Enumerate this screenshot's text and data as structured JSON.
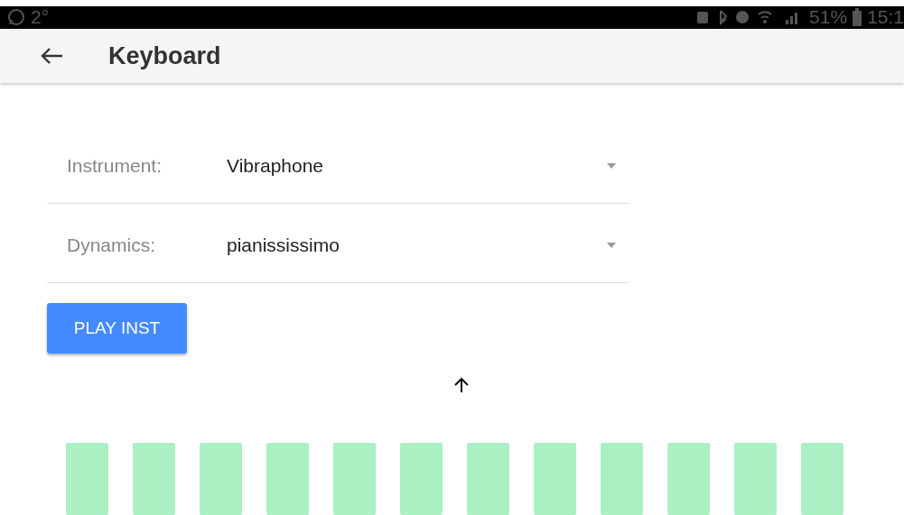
{
  "status_bar": {
    "temperature": "2°",
    "battery": "51%",
    "time": "15:1"
  },
  "app_bar": {
    "title": "Keyboard"
  },
  "fields": [
    {
      "label": "Instrument:",
      "value": "Vibraphone"
    },
    {
      "label": "Dynamics:",
      "value": "pianississimo"
    }
  ],
  "play_button": {
    "label": "PLAY INST"
  },
  "keys": [
    {
      "kind": "natural"
    },
    {
      "kind": "natural"
    },
    {
      "kind": "natural"
    },
    {
      "kind": "natural"
    },
    {
      "kind": "natural"
    },
    {
      "kind": "natural"
    },
    {
      "kind": "natural"
    },
    {
      "kind": "natural"
    },
    {
      "kind": "natural"
    },
    {
      "kind": "natural"
    },
    {
      "kind": "natural"
    },
    {
      "kind": "natural"
    }
  ]
}
